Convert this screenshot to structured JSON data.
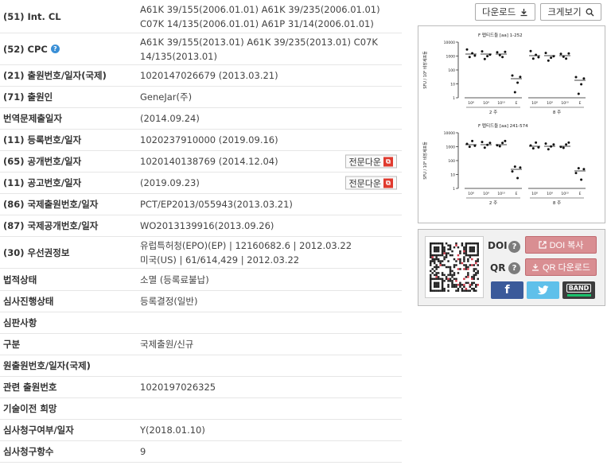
{
  "actions": {
    "download_label": "다운로드",
    "zoom_label": "크게보기"
  },
  "rows": [
    {
      "label": "(51) Int. CL",
      "lines": [
        "A61K 39/155(2006.01.01) A61K 39/235(2006.01.01)",
        "C07K 14/135(2006.01.01) A61P 31/14(2006.01.01)"
      ]
    },
    {
      "label": "(52) CPC",
      "lines": [
        "A61K 39/155(2013.01) A61K 39/235(2013.01) C07K",
        "14/135(2013.01)"
      ]
    },
    {
      "label": "(21) 출원번호/일자(국제)",
      "lines": [
        "1020147026679 (2013.03.21)"
      ]
    },
    {
      "label": "(71) 출원인",
      "lines": [
        "GeneJar(주)"
      ]
    },
    {
      "label": "번역문제출일자",
      "lines": [
        "(2014.09.24)"
      ]
    },
    {
      "label": "(11) 등록번호/일자",
      "lines": [
        "1020237910000 (2019.09.16)"
      ]
    },
    {
      "label": "(65) 공개번호/일자",
      "lines": [
        "1020140138769 (2014.12.04)"
      ],
      "pdf": "전문다운"
    },
    {
      "label": "(11) 공고번호/일자",
      "lines": [
        "(2019.09.23)"
      ],
      "pdf": "전문다운"
    },
    {
      "label": "(86) 국제출원번호/일자",
      "lines": [
        "PCT/EP2013/055943(2013.03.21)"
      ]
    },
    {
      "label": "(87) 국제공개번호/일자",
      "lines": [
        "WO2013139916(2013.09.26)"
      ]
    },
    {
      "label": "(30) 우선권정보",
      "lines": [
        "유럽특허청(EPO)(EP) | 12160682.6 | 2012.03.22",
        "미국(US) | 61/614,429 | 2012.03.22"
      ]
    },
    {
      "label": "법적상태",
      "lines": [
        "소멸 (등록료불납)"
      ]
    },
    {
      "label": "심사진행상태",
      "lines": [
        "등록결정(일반)"
      ]
    },
    {
      "label": "심판사항",
      "lines": [
        ""
      ]
    },
    {
      "label": "구분",
      "lines": [
        "국제출원/신규"
      ]
    },
    {
      "label": "원출원번호/일자(국제)",
      "lines": [
        ""
      ]
    },
    {
      "label": "관련 출원번호",
      "lines": [
        "1020197026325"
      ]
    },
    {
      "label": "기술이전 희망",
      "lines": [
        ""
      ]
    },
    {
      "label": "심사청구여부/일자",
      "lines": [
        "Y(2018.01.10)"
      ]
    },
    {
      "label": "심사청구항수",
      "lines": [
        "9"
      ]
    }
  ],
  "figure": {
    "plots": [
      {
        "title": "F 펩티드들 [aa] 1-252",
        "ylabel": "SFU / 10⁶ 비장세포들",
        "yticks": [
          "10000",
          "1000",
          "100",
          "10",
          "1"
        ],
        "groups": [
          {
            "label": "2 주",
            "ticks": [
              "10⁸",
              "10⁹",
              "10¹⁰",
              "E"
            ]
          },
          {
            "label": "8 주",
            "ticks": [
              "10⁸",
              "10⁹",
              "10¹⁰",
              "E"
            ]
          }
        ]
      },
      {
        "title": "F 펩티드들 [aa] 241-574",
        "ylabel": "SFU / 10⁶ 비장세포들",
        "yticks": [
          "10000",
          "1000",
          "100",
          "10",
          "1"
        ],
        "groups": [
          {
            "label": "2 주",
            "ticks": [
              "10⁸",
              "10⁹",
              "10¹⁰",
              "E"
            ]
          },
          {
            "label": "8 주",
            "ticks": [
              "10⁸",
              "10⁹",
              "10¹⁰",
              "E"
            ]
          }
        ]
      }
    ]
  },
  "share": {
    "doi_label": "DOI",
    "qr_label": "QR",
    "doi_copy_label": "DOI 복사",
    "qr_download_label": "QR 다운로드",
    "facebook": "f",
    "band": "BAND"
  },
  "colors": {
    "accent_pink": "#d98e92",
    "facebook": "#3b5a9a",
    "twitter": "#5fc0ea",
    "band": "#3c3c3c"
  }
}
